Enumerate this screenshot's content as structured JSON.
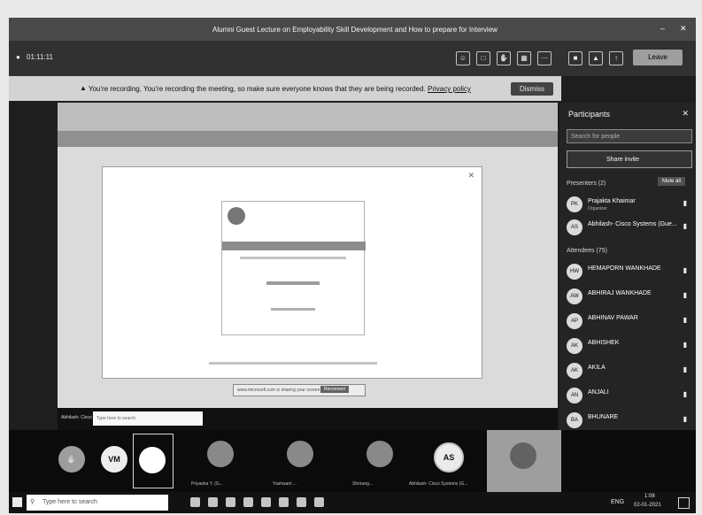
{
  "window": {
    "title": "Alumni Guest Lecture on Employability Skill Development and How to prepare for Interview",
    "timer": "01:11:11"
  },
  "toolbar": {
    "leave_label": "Leave"
  },
  "banner": {
    "message": "You're recording. You're recording the meeting, so make sure everyone knows that they are being recorded.",
    "link": "Privacy policy",
    "dismiss_label": "Dismiss"
  },
  "participants": {
    "title": "Participants",
    "search_placeholder": "Search for people",
    "share_invite": "Share invite",
    "presenters_header": "Presenters (2)",
    "mute_all": "Mute all",
    "presenters": [
      {
        "initials": "PK",
        "name": "Prajakta Khaimar",
        "sub": "Organizer"
      },
      {
        "initials": "AS",
        "name": "Abhilash- Cisco Systems (Gue..."
      }
    ],
    "attendees_header": "Attendees (75)",
    "attendees": [
      {
        "initials": "HW",
        "name": "HEMAPORN WANKHADE"
      },
      {
        "initials": "AW",
        "name": "ABHIRAJ WANKHADE"
      },
      {
        "initials": "AP",
        "name": "ABHINAV PAWAR"
      },
      {
        "initials": "AK",
        "name": "ABHISHEK"
      },
      {
        "initials": "AK",
        "name": "AKILA"
      },
      {
        "initials": "AN",
        "name": "ANJALI"
      },
      {
        "initials": "BA",
        "name": "BHUNARE"
      }
    ]
  },
  "share": {
    "presenter_label": "Abhilash- Cisco Systems",
    "windows_search": "Type here to search",
    "modal_button": "Reconnect",
    "notice": "www.microsoft.com is sharing your screen"
  },
  "video_strip": [
    {
      "initials": "VM",
      "name": ""
    },
    {
      "initials": "",
      "name": ""
    },
    {
      "initials": "",
      "name": "Priyanka Y. (G..."
    },
    {
      "initials": "",
      "name": "Yashwant ..."
    },
    {
      "initials": "",
      "name": "Shrirang..."
    },
    {
      "initials": "AS",
      "name": "Abhilash- Cisco Systems (G..."
    }
  ],
  "taskbar": {
    "search_placeholder": "Type here to search",
    "time": "1:08",
    "date": "02-01-2021",
    "lang": "ENG"
  }
}
